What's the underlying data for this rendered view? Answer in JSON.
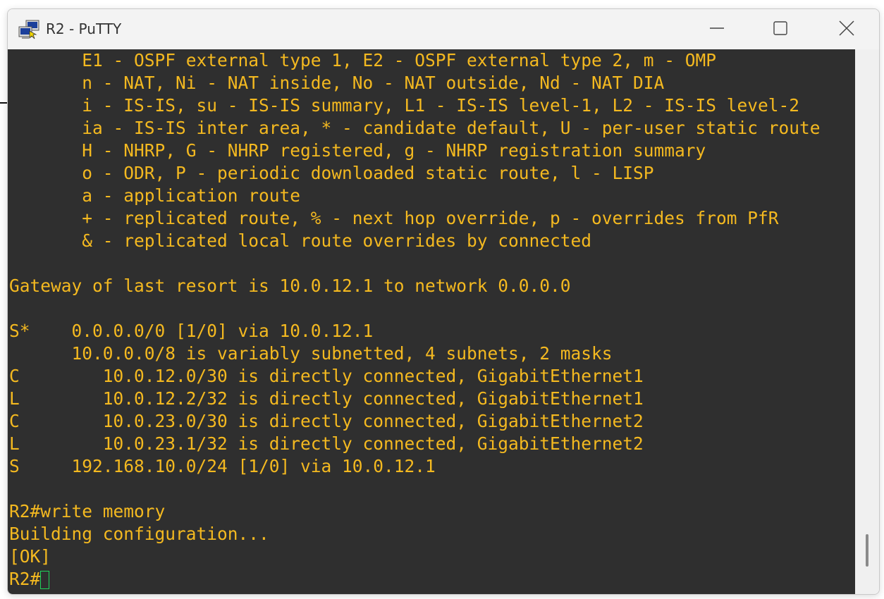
{
  "window": {
    "title": "R2 - PuTTY",
    "icon": "putty-app-icon"
  },
  "controls": {
    "minimize": "minimize-icon",
    "maximize": "maximize-icon",
    "close": "close-icon"
  },
  "terminal": {
    "foreground": "#f4b920",
    "background": "#2f2f2f",
    "cursor_color": "#1fd35a",
    "lines": [
      "       E1 - OSPF external type 1, E2 - OSPF external type 2, m - OMP",
      "       n - NAT, Ni - NAT inside, No - NAT outside, Nd - NAT DIA",
      "       i - IS-IS, su - IS-IS summary, L1 - IS-IS level-1, L2 - IS-IS level-2",
      "       ia - IS-IS inter area, * - candidate default, U - per-user static route",
      "       H - NHRP, G - NHRP registered, g - NHRP registration summary",
      "       o - ODR, P - periodic downloaded static route, l - LISP",
      "       a - application route",
      "       + - replicated route, % - next hop override, p - overrides from PfR",
      "       & - replicated local route overrides by connected",
      "",
      "Gateway of last resort is 10.0.12.1 to network 0.0.0.0",
      "",
      "S*    0.0.0.0/0 [1/0] via 10.0.12.1",
      "      10.0.0.0/8 is variably subnetted, 4 subnets, 2 masks",
      "C        10.0.12.0/30 is directly connected, GigabitEthernet1",
      "L        10.0.12.2/32 is directly connected, GigabitEthernet1",
      "C        10.0.23.0/30 is directly connected, GigabitEthernet2",
      "L        10.0.23.1/32 is directly connected, GigabitEthernet2",
      "S     192.168.10.0/24 [1/0] via 10.0.12.1",
      "",
      "R2#write memory",
      "Building configuration...",
      "[OK]"
    ],
    "prompt": "R2#"
  }
}
